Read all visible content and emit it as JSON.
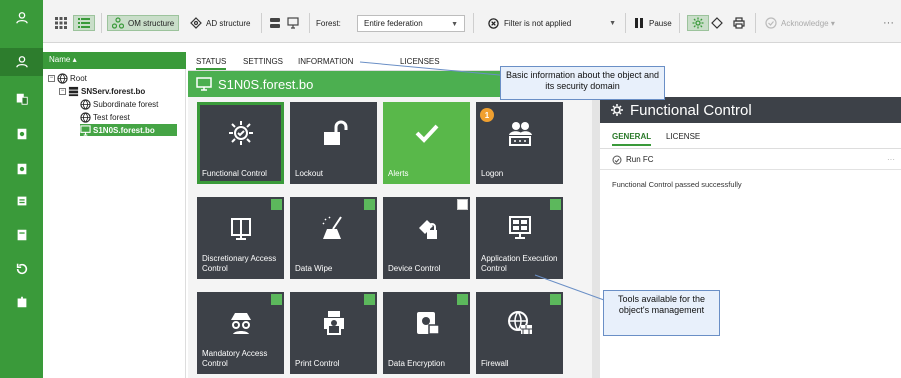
{
  "toolbar": {
    "om_structure": "OM structure",
    "ad_structure": "AD structure",
    "forest_label": "Forest:",
    "forest_value": "Entire federation",
    "filter_value": "Filter is not applied",
    "pause": "Pause",
    "acknowledge": "Acknowledge",
    "more": "···"
  },
  "tree": {
    "header": "Name",
    "sort_glyph": "▴",
    "nodes": [
      "Root",
      "SNServ.forest.bo",
      "Subordinate forest",
      "Test forest",
      "S1N0S.forest.bo"
    ]
  },
  "tabs": [
    "STATUS",
    "SETTINGS",
    "INFORMATION",
    "LICENSES"
  ],
  "object_title": "S1N0S.forest.bo",
  "tiles": [
    {
      "label": "Functional Control",
      "icon": "functional-control-icon"
    },
    {
      "label": "Lockout",
      "icon": "lock-open-icon"
    },
    {
      "label": "Alerts",
      "icon": "checkmark-icon"
    },
    {
      "label": "Logon",
      "icon": "logon-icon",
      "badge": "1"
    },
    {
      "label": "Discretionary Access Control",
      "icon": "folder-icon"
    },
    {
      "label": "Data Wipe",
      "icon": "broom-icon"
    },
    {
      "label": "Device Control",
      "icon": "usb-lock-icon"
    },
    {
      "label": "Application Execution Control",
      "icon": "app-control-icon"
    },
    {
      "label": "Mandatory Access Control",
      "icon": "spy-icon"
    },
    {
      "label": "Print Control",
      "icon": "printer-icon"
    },
    {
      "label": "Data Encryption",
      "icon": "disk-lock-icon"
    },
    {
      "label": "Firewall",
      "icon": "firewall-icon"
    }
  ],
  "right_panel": {
    "title": "Functional Control",
    "tabs": [
      "GENERAL",
      "LICENSE"
    ],
    "run": "Run FC",
    "message": "Functional Control passed successfully",
    "more": "···"
  },
  "callouts": {
    "info": "Basic information about the object and its security domain",
    "tools": "Tools available for the object's management"
  },
  "colors": {
    "accent": "#3a9a3a",
    "tile": "#3d4148",
    "tile_active": "#59b84a"
  }
}
